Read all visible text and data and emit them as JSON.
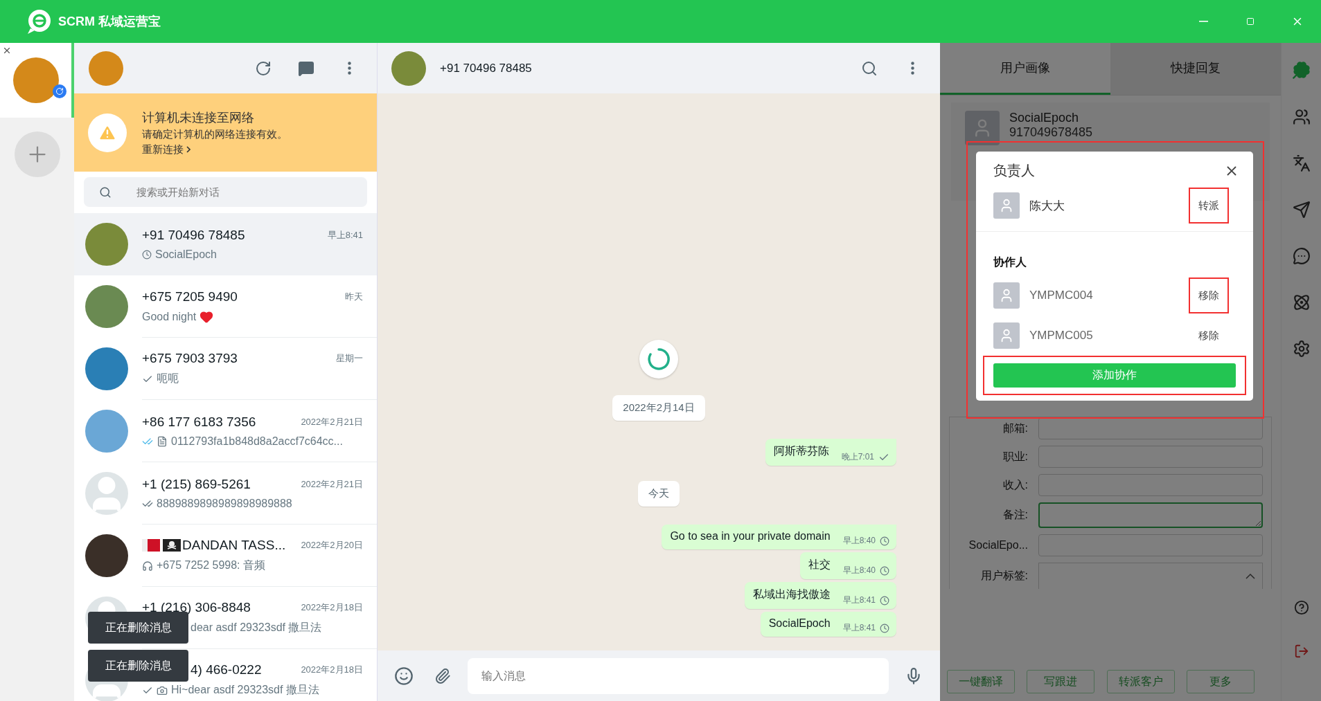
{
  "app": {
    "title": "SCRM 私域运营宝"
  },
  "account": {
    "selected": true
  },
  "chat_list": {
    "banner": {
      "title": "计算机未连接至网络",
      "message": "请确定计算机的网络连接有效。",
      "link": "重新连接"
    },
    "search": {
      "placeholder": "搜索或开始新对话"
    },
    "chats": [
      {
        "name": "+91 70496 78485",
        "time": "早上8:41",
        "preview": "SocialEpoch",
        "receipt": {
          "kind": "clock"
        },
        "avatar": {
          "kind": "photo"
        },
        "selected": true
      },
      {
        "name": "+675 7205 9490",
        "time": "昨天",
        "preview": "Good night",
        "avatar": {
          "kind": "photo"
        },
        "heart": true,
        "selected": false
      },
      {
        "name": "+675 7903 3793",
        "time": "星期一",
        "preview": "呃呃",
        "receipt": {
          "kind": "sent"
        },
        "avatar": {
          "kind": "photo"
        },
        "selected": false
      },
      {
        "name": "+86 177 6183 7356",
        "time": "2022年2月21日",
        "preview": "0112793fa1b848d8a2accf7c64cc...",
        "receipt": {
          "kind": "read"
        },
        "attachment": {
          "kind": "document"
        },
        "avatar": {
          "kind": "photo"
        },
        "selected": false
      },
      {
        "name": "+1 (215) 869-5261",
        "time": "2022年2月21日",
        "preview": "8889889898989898989888",
        "receipt": {
          "kind": "delivered"
        },
        "avatar": {
          "kind": "default"
        },
        "selected": false
      },
      {
        "name": "DANDAN TASS...",
        "time": "2022年2月20日",
        "preview": "+675 7252 5998: 音频",
        "attachment": {
          "kind": "audio"
        },
        "avatar": {
          "kind": "photo"
        },
        "flags": true,
        "selected": false
      },
      {
        "name": "+1 (216) 306-8848",
        "time": "2022年2月18日",
        "preview": "dear asdf 29323sdf 撒旦法",
        "avatar": {
          "kind": "default"
        },
        "selected": false
      },
      {
        "name": "4) 466-0222",
        "time": "2022年2月18日",
        "preview": "Hi~dear asdf 29323sdf 撒旦法",
        "receipt": {
          "kind": "sent"
        },
        "attachment": {
          "kind": "photo"
        },
        "avatar": {
          "kind": "default"
        },
        "selected": false
      }
    ]
  },
  "toasts": [
    "正在删除消息",
    "正在删除消息"
  ],
  "chat": {
    "title": "+91 70496 78485",
    "loading": true,
    "messages": [
      {
        "kind": "date",
        "text": "2022年2月14日"
      },
      {
        "kind": "out",
        "text": "阿斯蒂芬陈",
        "time": "晚上7:01",
        "receipt": {
          "kind": "sent"
        },
        "tail": true
      },
      {
        "kind": "date",
        "text": "今天"
      },
      {
        "kind": "out",
        "text": "Go to sea in your private domain",
        "time": "早上8:40",
        "receipt": {
          "kind": "clock"
        },
        "tail": true
      },
      {
        "kind": "out",
        "text": "社交",
        "time": "早上8:40",
        "receipt": {
          "kind": "clock"
        },
        "tail": false
      },
      {
        "kind": "out",
        "text": "私域出海找傲途",
        "time": "早上8:41",
        "receipt": {
          "kind": "clock"
        },
        "tail": false
      },
      {
        "kind": "out",
        "text": "SocialEpoch",
        "time": "早上8:41",
        "receipt": {
          "kind": "clock"
        },
        "tail": false
      }
    ],
    "input": {
      "placeholder": "输入消息"
    }
  },
  "profile": {
    "tabs": [
      {
        "label": "用户画像",
        "selected": true
      },
      {
        "label": "快捷回复",
        "selected": false
      }
    ],
    "card": {
      "name": "SocialEpoch",
      "phone": "917049678485"
    },
    "fields": [
      {
        "label": "邮箱:",
        "kind": "input",
        "focused": false
      },
      {
        "label": "职业:",
        "kind": "input",
        "focused": false
      },
      {
        "label": "收入:",
        "kind": "input",
        "focused": false
      },
      {
        "label": "备注:",
        "kind": "textarea",
        "focused": true
      },
      {
        "label": "SocialEpo...",
        "kind": "input",
        "focused": false
      },
      {
        "label": "用户标签:",
        "kind": "tags",
        "focused": false
      }
    ],
    "buttons": [
      "一键翻译",
      "写跟进",
      "转派客户",
      "更多"
    ]
  },
  "dialog": {
    "title": "负责人",
    "highlighted": true,
    "owner": {
      "name": "陈大大",
      "action": "转派",
      "highlighted": true
    },
    "section": "协作人",
    "collaborators": [
      {
        "name": "YMPMC004",
        "action": "移除",
        "highlighted": true
      },
      {
        "name": "YMPMC005",
        "action": "移除",
        "highlighted": false
      }
    ],
    "add_button": {
      "label": "添加协作",
      "highlighted": true
    }
  }
}
